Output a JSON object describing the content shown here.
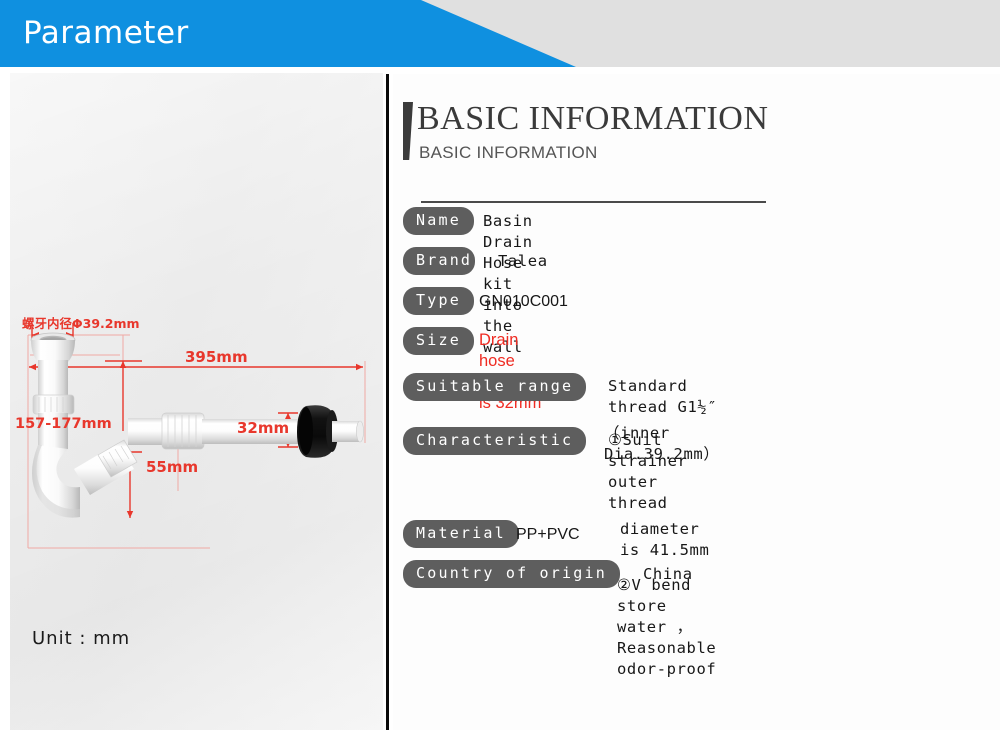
{
  "banner": {
    "title": "Parameter",
    "blue": "#0f90e0",
    "gray": "#e0e0e0"
  },
  "left_panel": {
    "unit_label": "Unit : mm",
    "dimensions": {
      "thread_inner_diameter": "螺牙内径Φ39.2mm",
      "total_length": "395mm",
      "height_range": "157-177mm",
      "hose_diameter": "32mm",
      "outlet_height": "55mm"
    },
    "dimension_color": "#e8372c"
  },
  "heading": {
    "main": "BASIC INFORMATION",
    "sub": "BASIC INFORMATION"
  },
  "specs": [
    {
      "label": "Name",
      "value": "Basin Drain Hose kit into the wall",
      "style": "mono"
    },
    {
      "label": "Brand",
      "value": "Talea",
      "style": "mono"
    },
    {
      "label": "Type",
      "value": "GN010C001",
      "style": "sans"
    },
    {
      "label": "Size",
      "value": "Drain hose diameter is 32mm",
      "style": "red"
    },
    {
      "label": "Suitable range",
      "value_lines": [
        "Standard thread G1½″",
        "（inner Dia.39.2mm）"
      ],
      "style": "mono"
    },
    {
      "label": "Characteristic",
      "value_lines": [
        "①Suit strainer outer thread",
        "diameter is 41.5mm",
        "②V bend store water ， Reasonable odor-proof"
      ],
      "style": "mono"
    },
    {
      "label": "Material",
      "value": "PP+PVC",
      "style": "sans"
    },
    {
      "label": "Country of origin",
      "value": "China",
      "style": "mono"
    }
  ],
  "colors": {
    "pill_bg": "#5e5e5e",
    "pill_text": "#ffffff",
    "accent": "#3b3b3b",
    "red": "#ef2b22"
  }
}
